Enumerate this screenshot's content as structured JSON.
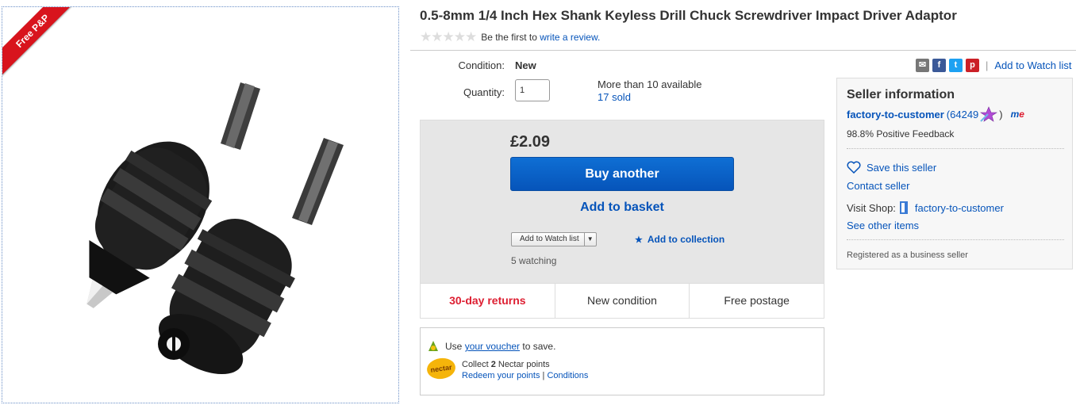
{
  "image": {
    "ribbon_text": "Free P&P"
  },
  "title": "0.5-8mm 1/4 Inch Hex Shank Keyless Drill Chuck Screwdriver Impact Driver Adaptor",
  "rating": {
    "stars_filled": 0,
    "stars_total": 5,
    "prefix": "Be the first to",
    "link": "write a review."
  },
  "details": {
    "condition_label": "Condition:",
    "condition_value": "New",
    "quantity_label": "Quantity:",
    "quantity_value": "1",
    "availability": "More than 10 available",
    "sold": "17 sold"
  },
  "buybox": {
    "price": "£2.09",
    "buy_label": "Buy another",
    "basket_label": "Add to basket",
    "watch_dropdown": "Add to Watch list",
    "collection_label": "Add to collection",
    "watching": "5 watching",
    "colors": {
      "buy": "#0654ba",
      "link": "#0654ba",
      "returns": "#dd1e31"
    }
  },
  "features": [
    "30-day returns",
    "New condition",
    "Free postage"
  ],
  "voucher": {
    "prefix": "Use",
    "link": "your voucher",
    "suffix": "to save."
  },
  "nectar": {
    "logo": "nectar",
    "collect_prefix": "Collect",
    "points": "2",
    "collect_suffix": "Nectar points",
    "redeem": "Redeem your points",
    "sep": "|",
    "conditions": "Conditions"
  },
  "share": {
    "icons": [
      "email-icon",
      "facebook-icon",
      "twitter-icon",
      "pinterest-icon"
    ],
    "watch_link": "Add to Watch list"
  },
  "seller": {
    "heading": "Seller information",
    "name": "factory-to-customer",
    "count": "(64249",
    "close_paren": ")",
    "me_logo_m": "m",
    "me_logo_e": "e",
    "feedback": "98.8% Positive Feedback",
    "save": "Save this seller",
    "contact": "Contact seller",
    "visit_label": "Visit Shop:",
    "shop_name": "factory-to-customer",
    "other_items": "See other items",
    "registered": "Registered as a business seller"
  }
}
